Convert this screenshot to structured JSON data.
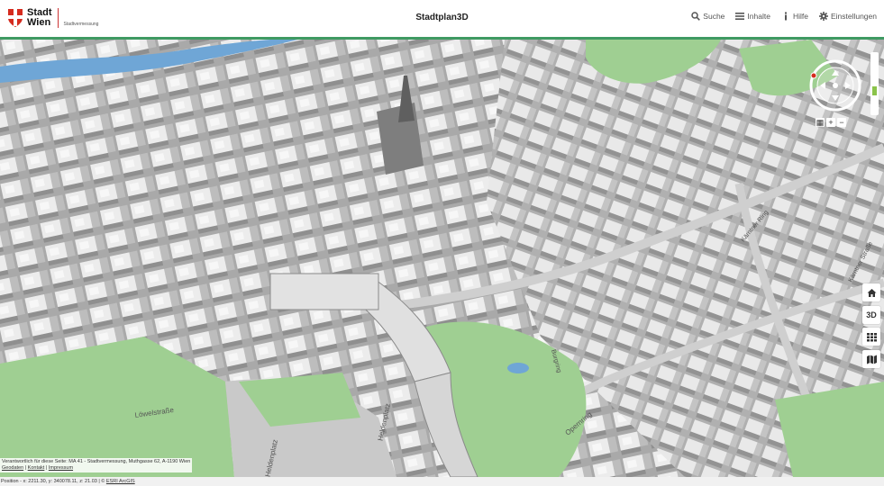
{
  "header": {
    "logo_line1": "Stadt",
    "logo_line2": "Wien",
    "logo_sub": "Stadtvermessung",
    "title": "Stadtplan3D",
    "nav": [
      {
        "label": "Suche",
        "icon": "search-icon"
      },
      {
        "label": "Inhalte",
        "icon": "menu-icon"
      },
      {
        "label": "Hilfe",
        "icon": "info-icon"
      },
      {
        "label": "Einstellungen",
        "icon": "gear-icon"
      }
    ]
  },
  "map": {
    "street_labels": [
      "Löwelstraße",
      "Heldenplatz",
      "Heldenplatz",
      "Opernring",
      "Kärntner Ring",
      "Kärntner Straße",
      "Burgring"
    ],
    "colors": {
      "buildings": "#e6e6e6",
      "roofs": "#f3f3f3",
      "shadow": "#9a9a9a",
      "park": "#9fcf92",
      "water": "#6fa6d6",
      "ground": "#d4d4d4"
    }
  },
  "controls": {
    "zoom_in": "+",
    "zoom_out": "−",
    "side_buttons": [
      {
        "name": "home-button",
        "icon": "home-icon"
      },
      {
        "name": "3d-button",
        "label": "3D"
      },
      {
        "name": "grid-button",
        "icon": "grid-icon"
      },
      {
        "name": "map-button",
        "icon": "map-icon"
      }
    ]
  },
  "footer": {
    "responsible": "Verantwortlich für diese Seite: MA 41 - Stadtvermessung, Muthgasse 62, A-1190 Wien",
    "links": [
      "Geodaten",
      "Kontakt",
      "Impressum"
    ],
    "position": "Position - x: 2211.30, y: 340078.11, z: 21.03 | ©",
    "esri": "ESRI ArcGIS"
  }
}
